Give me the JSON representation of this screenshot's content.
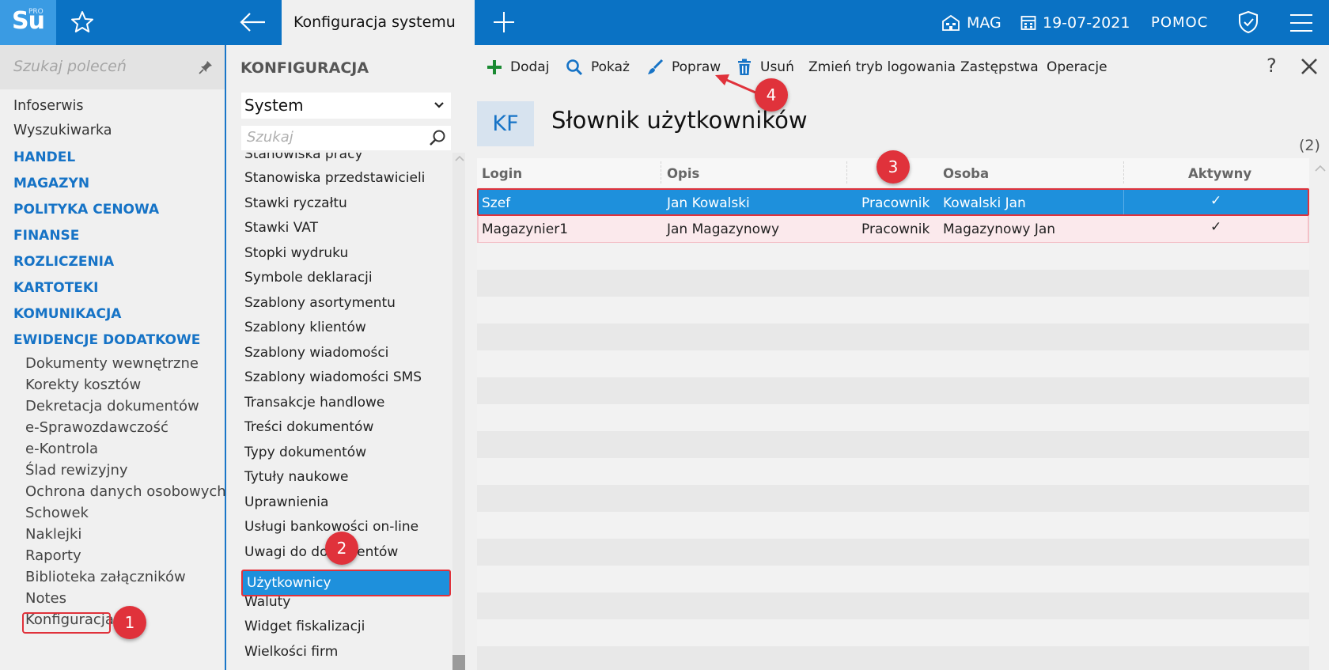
{
  "topbar": {
    "logo": "Su",
    "logo_badge": "PRO",
    "active_tab": "Konfiguracja systemu",
    "warehouse": "MAG",
    "date": "19-07-2021",
    "help": "POMOC"
  },
  "sidebar": {
    "search_placeholder": "Szukaj poleceń",
    "items": [
      "Infoserwis",
      "Wyszukiwarka"
    ],
    "categories": [
      "HANDEL",
      "MAGAZYN",
      "POLITYKA CENOWA",
      "FINANSE",
      "ROZLICZENIA",
      "KARTOTEKI",
      "KOMUNIKACJA",
      "EWIDENCJE DODATKOWE"
    ],
    "subitems": [
      "Dokumenty wewnętrzne",
      "Korekty kosztów",
      "Dekretacja dokumentów",
      "e-Sprawozdawczość",
      "e-Kontrola",
      "Ślad rewizyjny",
      "Ochrona danych osobowych",
      "Schowek",
      "Naklejki",
      "Raporty",
      "Biblioteka załączników",
      "Notes",
      "Konfiguracja"
    ]
  },
  "midpanel": {
    "title": "KONFIGURACJA",
    "select_value": "System",
    "search_placeholder": "Szukaj",
    "items": [
      "Stanowiska pracy",
      "Stanowiska przedstawicieli",
      "Stawki ryczałtu",
      "Stawki VAT",
      "Stopki wydruku",
      "Symbole deklaracji",
      "Szablony asortymentu",
      "Szablony klientów",
      "Szablony wiadomości",
      "Szablony wiadomości SMS",
      "Transakcje handlowe",
      "Treści dokumentów",
      "Typy dokumentów",
      "Tytuły naukowe",
      "Uprawnienia",
      "Usługi bankowości on-line",
      "Uwagi do dokumentów",
      "Użytkownicy",
      "Waluty",
      "Widget fiskalizacji",
      "Wielkości firm"
    ],
    "selected": "Użytkownicy"
  },
  "toolbar": {
    "add": "Dodaj",
    "show": "Pokaż",
    "edit": "Popraw",
    "delete": "Usuń",
    "change_login": "Zmień tryb logowania",
    "substitution": "Zastępstwa",
    "operations": "Operacje",
    "help": "?"
  },
  "content": {
    "badge": "KF",
    "title": "Słownik użytkowników",
    "count": "(2)"
  },
  "table": {
    "columns": [
      "Login",
      "Opis",
      "Osoba",
      "Aktywny"
    ],
    "rows": [
      {
        "login": "Szef",
        "opis": "Jan Kowalski",
        "typ": "Pracownik",
        "osoba": "Kowalski Jan",
        "aktywny": "✓"
      },
      {
        "login": "Magazynier1",
        "opis": "Jan Magazynowy",
        "typ": "Pracownik",
        "osoba": "Magazynowy Jan",
        "aktywny": "✓"
      }
    ]
  },
  "markers": [
    "1",
    "2",
    "3",
    "4"
  ],
  "colors": {
    "primary": "#0a72c4",
    "selection": "#1e90dc",
    "highlight": "#e0323b",
    "category": "#1673c6"
  }
}
